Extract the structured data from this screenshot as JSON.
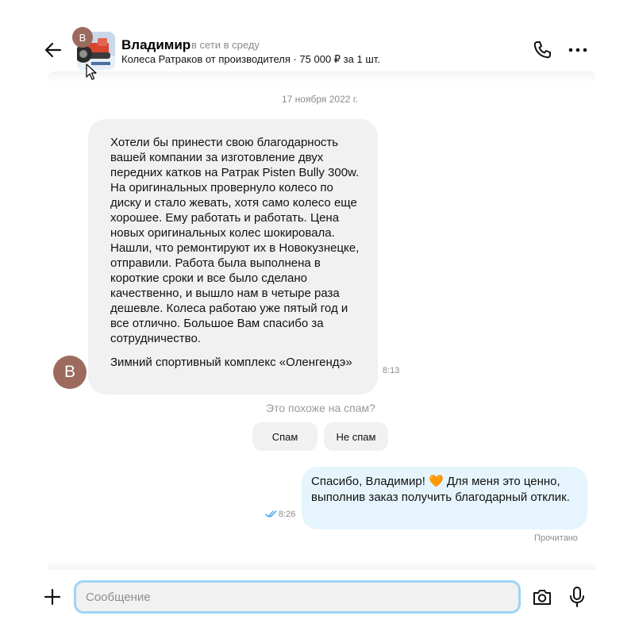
{
  "header": {
    "avatar_initial": "В",
    "contact_name": "Владимир",
    "status": "в сети в среду",
    "listing_subtitle": "Колеса Ратраков от производителя · 75 000 ₽ за 1 шт.",
    "icons": [
      "arrow-left-icon",
      "phone-icon",
      "more-dots-icon"
    ]
  },
  "chat": {
    "date_label": "17 ноября 2022 г.",
    "incoming": {
      "avatar_initial": "В",
      "paragraph_1": "Хотели бы принести свою благодарность вашей компании за изготовление двух передних катков на Ратрак Pisten Bully 300w. На оригинальных провернуло колесо по диску и стало жевать, хотя само колесо еще хорошее. Ему работать и работать. Цена новых оригинальных колес шокировала. Нашли, что ремонтируют их в Новокузнецке, отправили. Работа была выполнена в короткие сроки и все было сделано качественно, и вышло нам в четыре раза дешевле. Колеса работаю уже пятый год и все отлично. Большое Вам спасибо за сотрудничество.",
      "paragraph_2": "Зимний спортивный комплекс «Оленгендэ»",
      "time": "8:13"
    },
    "spam_prompt": {
      "question": "Это похоже на спам?",
      "yes_label": "Спам",
      "no_label": "Не спам"
    },
    "outgoing": {
      "text": "Спасибо, Владимир! 🧡 Для меня это ценно, выполнив заказ получить благодарный отклик.",
      "time": "8:26",
      "read_status": "Прочитано"
    }
  },
  "composer": {
    "placeholder": "Сообщение",
    "icons": [
      "plus-icon",
      "camera-icon",
      "microphone-icon"
    ]
  },
  "colors": {
    "avatar": "#9c6b5e",
    "incoming_bubble": "#f1f1f1",
    "outgoing_bubble": "#e6f5fd",
    "input_focus_border": "#9fd3f7",
    "read_check": "#3b9ae1"
  }
}
